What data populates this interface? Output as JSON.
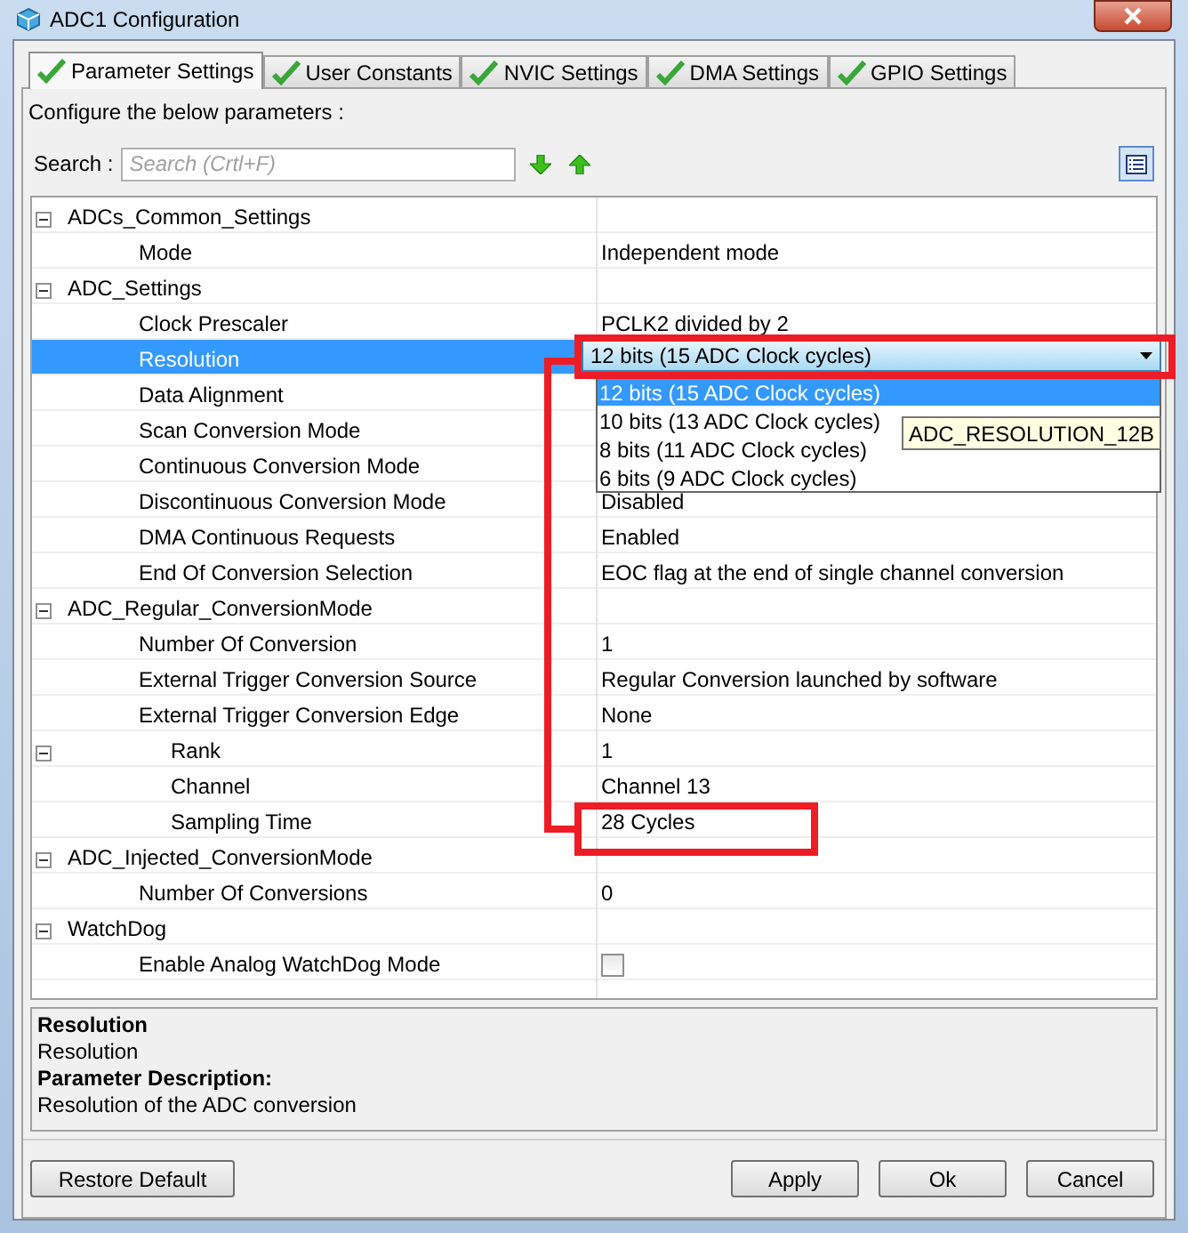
{
  "window": {
    "title": "ADC1 Configuration"
  },
  "tabs": [
    {
      "label": "Parameter Settings",
      "selected": true
    },
    {
      "label": "User Constants",
      "selected": false
    },
    {
      "label": "NVIC Settings",
      "selected": false
    },
    {
      "label": "DMA Settings",
      "selected": false
    },
    {
      "label": "GPIO Settings",
      "selected": false
    }
  ],
  "intro": "Configure the below parameters :",
  "search": {
    "label": "Search :",
    "placeholder": "Search (Crtl+F)"
  },
  "tree": [
    {
      "label": "ADCs_Common_Settings",
      "expanded": true,
      "selected": false,
      "children": [
        {
          "label": "Mode",
          "value": "Independent mode",
          "kind": "text",
          "selected": false
        }
      ]
    },
    {
      "label": "ADC_Settings",
      "expanded": true,
      "selected": false,
      "children": [
        {
          "label": "Clock Prescaler",
          "value": "PCLK2 divided by 2",
          "kind": "text",
          "selected": false
        },
        {
          "label": "Resolution",
          "kind": "dropdown",
          "selected": true
        },
        {
          "label": "Data Alignment",
          "kind": "text",
          "selected": false
        },
        {
          "label": "Scan Conversion Mode",
          "kind": "text",
          "selected": false
        },
        {
          "label": "Continuous Conversion Mode",
          "kind": "text",
          "selected": false
        },
        {
          "label": "Discontinuous Conversion Mode",
          "value": "Disabled",
          "kind": "text",
          "selected": false
        },
        {
          "label": "DMA Continuous Requests",
          "value": "Enabled",
          "kind": "text",
          "selected": false
        },
        {
          "label": "End Of Conversion Selection",
          "value": "EOC flag at the end of single channel conversion",
          "kind": "text",
          "selected": false
        }
      ]
    },
    {
      "label": "ADC_Regular_ConversionMode",
      "expanded": true,
      "selected": false,
      "children": [
        {
          "label": "Number Of Conversion",
          "value": "1",
          "kind": "text",
          "selected": false
        },
        {
          "label": "External Trigger Conversion Source",
          "value": "Regular Conversion launched by software",
          "kind": "text",
          "selected": false
        },
        {
          "label": "External Trigger Conversion Edge",
          "value": "None",
          "kind": "text",
          "selected": false
        },
        {
          "label": "Rank",
          "value": "1",
          "kind": "text",
          "expanded": true,
          "selected": false,
          "children": [
            {
              "label": "Channel",
              "value": "Channel 13",
              "kind": "text",
              "selected": false
            },
            {
              "label": "Sampling Time",
              "value": "28 Cycles",
              "kind": "text",
              "selected": false
            }
          ]
        }
      ]
    },
    {
      "label": "ADC_Injected_ConversionMode",
      "expanded": true,
      "selected": false,
      "children": [
        {
          "label": "Number Of Conversions",
          "value": "0",
          "kind": "text",
          "selected": false
        }
      ]
    },
    {
      "label": "WatchDog",
      "expanded": true,
      "selected": false,
      "children": [
        {
          "label": "Enable Analog WatchDog Mode",
          "kind": "checkbox",
          "checked": false,
          "selected": false
        }
      ]
    }
  ],
  "dropdown": {
    "value": "12 bits (15 ADC Clock cycles)",
    "options": [
      {
        "label": "12 bits (15 ADC Clock cycles)",
        "selected": true
      },
      {
        "label": "10 bits (13 ADC Clock cycles)",
        "selected": false
      },
      {
        "label": "8 bits (11 ADC Clock cycles)",
        "selected": false
      },
      {
        "label": "6 bits (9 ADC Clock cycles)",
        "selected": false
      }
    ],
    "tooltip": "ADC_RESOLUTION_12B"
  },
  "description": {
    "title": "Resolution",
    "name": "Resolution",
    "heading": "Parameter Description:",
    "text": "Resolution of the ADC conversion"
  },
  "buttons_left": [
    "Restore Default"
  ],
  "buttons_right": [
    "Apply",
    "Ok",
    "Cancel"
  ]
}
